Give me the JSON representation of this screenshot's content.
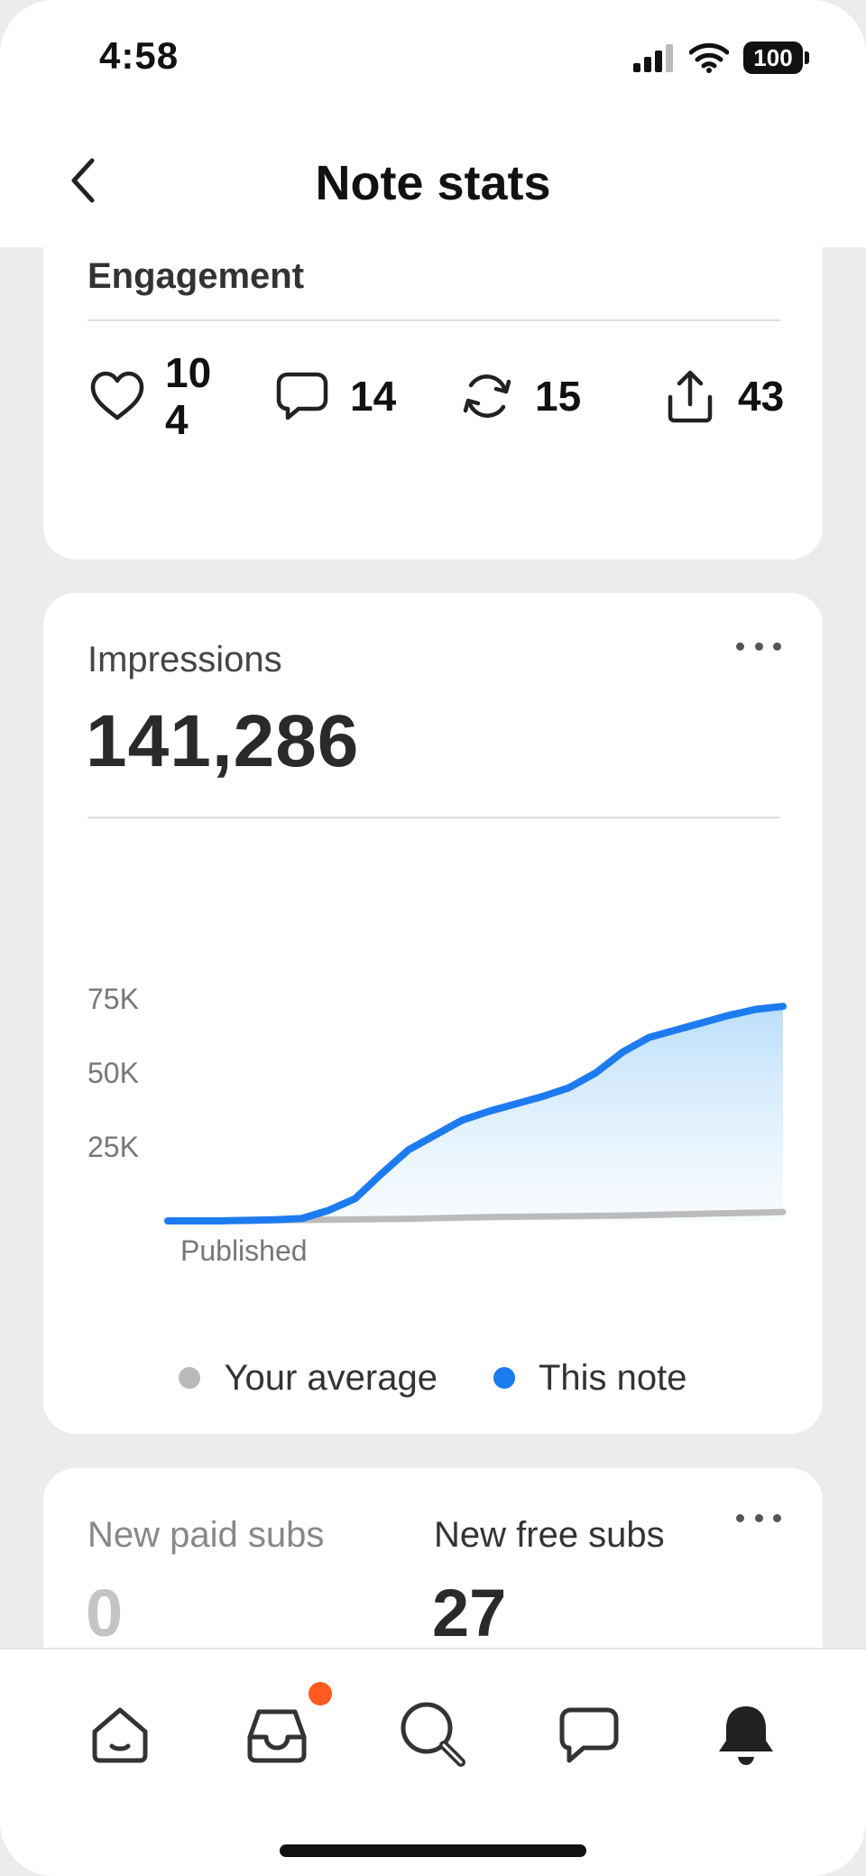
{
  "status_bar": {
    "time": "4:58",
    "battery": "100",
    "icons": [
      "cellular-signal-icon",
      "wifi-icon",
      "battery-icon"
    ]
  },
  "header": {
    "title": "Note stats",
    "back_icon": "chevron-left-icon"
  },
  "engagement": {
    "title": "Engagement",
    "items": [
      {
        "icon": "heart-icon",
        "value": "104"
      },
      {
        "icon": "comment-icon",
        "value": "14"
      },
      {
        "icon": "restack-icon",
        "value": "15"
      },
      {
        "icon": "share-icon",
        "value": "43"
      }
    ]
  },
  "impressions": {
    "label": "Impressions",
    "value": "141,286",
    "more_icon": "more-horizontal-icon"
  },
  "chart_data": {
    "type": "area",
    "title": "",
    "xlabel": "Published",
    "ylabel": "",
    "yticks": [
      "25K",
      "50K",
      "75K"
    ],
    "ylim": [
      0,
      75000
    ],
    "grid": false,
    "legend_placement": "bottom-center",
    "x": [
      0,
      1,
      2,
      3,
      4,
      5,
      6,
      7,
      8,
      9,
      10,
      11,
      12,
      13,
      14,
      15,
      16,
      17,
      18,
      19,
      20,
      21,
      22,
      23
    ],
    "series": [
      {
        "name": "Your average",
        "color": "#bbbbbb",
        "values": [
          0,
          0,
          0,
          0,
          200,
          300,
          400,
          500,
          600,
          700,
          900,
          1100,
          1300,
          1400,
          1500,
          1600,
          1700,
          1800,
          2000,
          2200,
          2400,
          2600,
          2800,
          3000
        ]
      },
      {
        "name": "This note",
        "color": "#1d7bf0",
        "values": [
          0,
          0,
          0,
          200,
          400,
          800,
          3500,
          7500,
          16000,
          24000,
          29000,
          34000,
          37000,
          39500,
          42000,
          45000,
          50000,
          57000,
          62000,
          64500,
          67000,
          69500,
          71500,
          72500
        ]
      }
    ]
  },
  "legend": {
    "items": [
      {
        "label": "Your average",
        "color": "#b9b9b9"
      },
      {
        "label": "This note",
        "color": "#1d7bf0"
      }
    ]
  },
  "subs": {
    "paid_label": "New paid subs",
    "paid_value": "0",
    "free_label": "New free subs",
    "free_value": "27"
  },
  "tab_bar": {
    "items": [
      "home-icon",
      "inbox-icon",
      "search-icon",
      "chat-icon",
      "notifications-icon"
    ],
    "accent": "#ff5a1f"
  }
}
